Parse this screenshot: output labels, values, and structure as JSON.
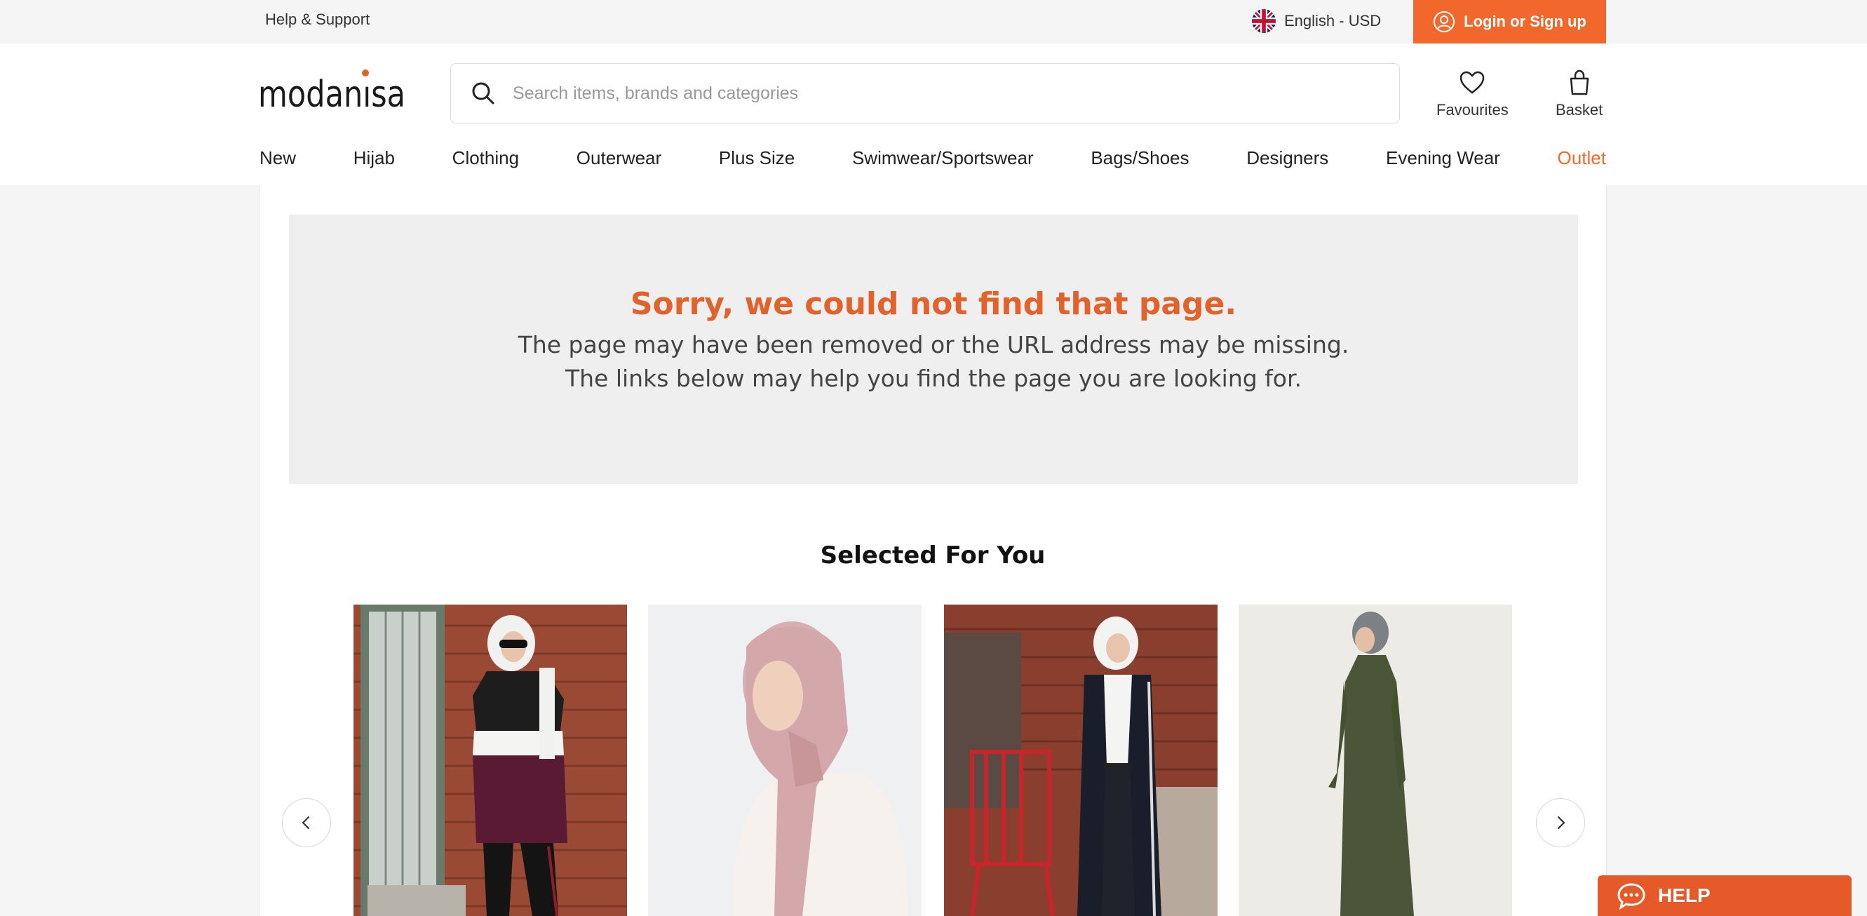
{
  "topbar": {
    "help_support": "Help & Support",
    "language": "English - USD",
    "login": "Login or Sign up"
  },
  "header": {
    "logo_text": "modanisa",
    "search_placeholder": "Search items, brands and categories",
    "favourites": "Favourites",
    "basket": "Basket"
  },
  "nav": {
    "items": [
      "New",
      "Hijab",
      "Clothing",
      "Outerwear",
      "Plus Size",
      "Swimwear/Sportswear",
      "Bags/Shoes",
      "Designers",
      "Evening Wear",
      "Outlet"
    ]
  },
  "error": {
    "title": "Sorry, we could not find that page.",
    "line1": "The page may have been removed or the URL address may be missing.",
    "line2": "The links below may help you find the page you are looking for."
  },
  "selected": {
    "title": "Selected For You"
  },
  "help_widget": {
    "label": "HELP"
  },
  "colors": {
    "accent": "#f2682c",
    "error_title": "#e2622c",
    "help_widget": "#e65a2a"
  },
  "icons": [
    "search-icon",
    "heart-icon",
    "basket-icon",
    "user-icon",
    "uk-flag-icon",
    "chevron-left-icon",
    "chevron-right-icon",
    "chat-icon"
  ]
}
